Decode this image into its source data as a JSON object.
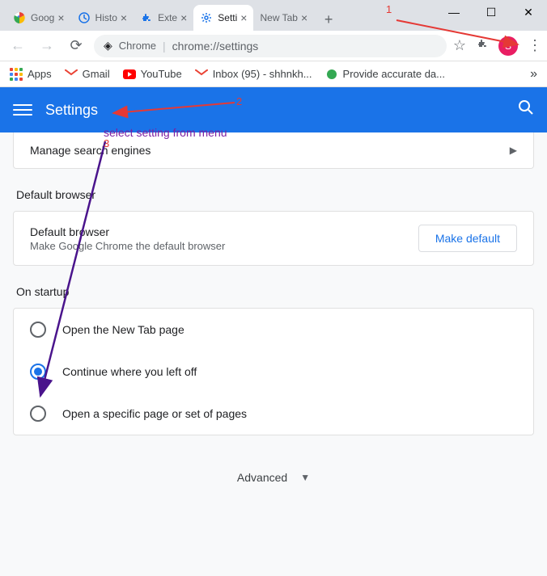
{
  "window": {
    "minimize": "—",
    "maximize": "☐",
    "close": "✕"
  },
  "tabs": [
    {
      "label": "Goog",
      "favicon": "chrome"
    },
    {
      "label": "Histo",
      "favicon": "history"
    },
    {
      "label": "Exte",
      "favicon": "extension"
    },
    {
      "label": "Setti",
      "favicon": "settings",
      "active": true
    },
    {
      "label": "New Tab",
      "favicon": ""
    }
  ],
  "omnibox": {
    "secure_label": "Chrome",
    "url": "chrome://settings"
  },
  "avatar_initial": "S",
  "bookmarks": [
    {
      "label": "Apps",
      "icon": "apps"
    },
    {
      "label": "Gmail",
      "icon": "gmail"
    },
    {
      "label": "YouTube",
      "icon": "youtube"
    },
    {
      "label": "Inbox (95) - shhnkh...",
      "icon": "gmail"
    },
    {
      "label": "Provide accurate da...",
      "icon": "green"
    }
  ],
  "settings": {
    "header_title": "Settings",
    "manage_search": "Manage search engines",
    "default_browser_section": "Default browser",
    "default_browser_title": "Default browser",
    "default_browser_sub": "Make Google Chrome the default browser",
    "make_default_button": "Make default",
    "startup_section": "On startup",
    "startup_options": [
      "Open the New Tab page",
      "Continue where you left off",
      "Open a specific page or set of pages"
    ],
    "startup_selected": 1,
    "advanced_label": "Advanced"
  },
  "annotations": {
    "num1": "1",
    "num2": "2",
    "num3": "3",
    "text": "select setting from menu"
  }
}
